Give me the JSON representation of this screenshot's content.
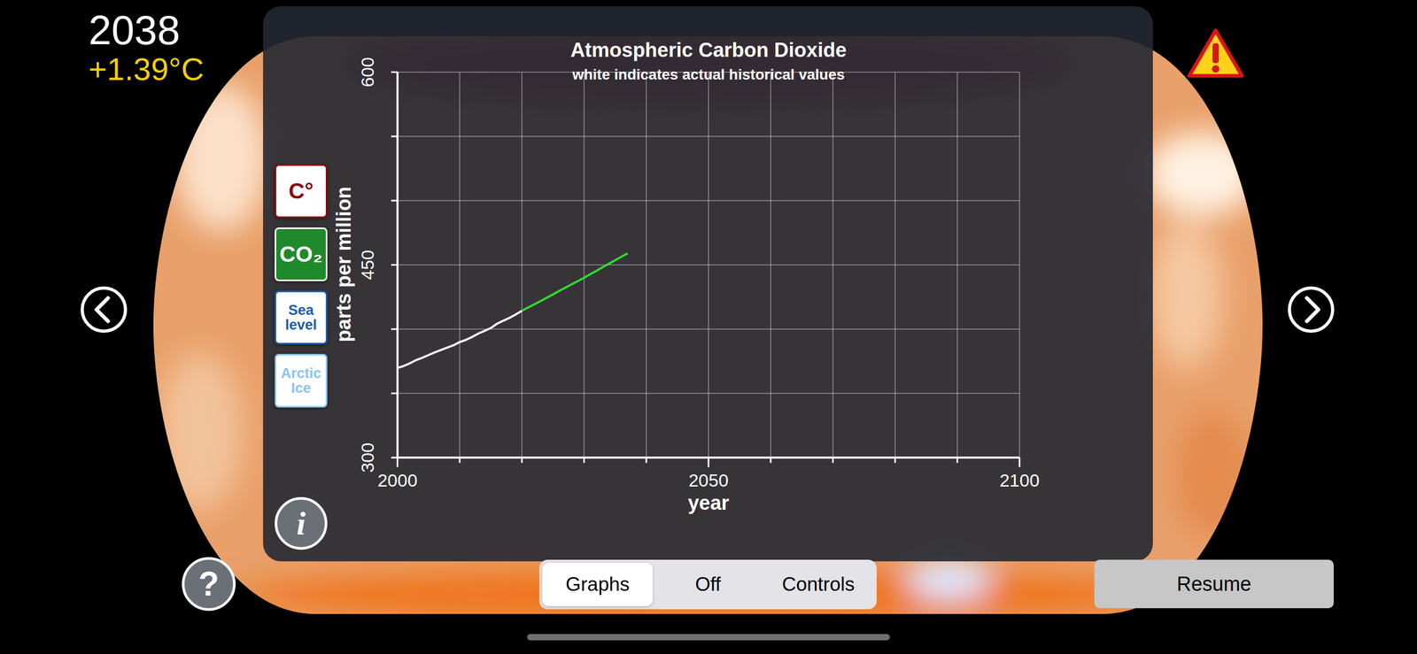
{
  "status": {
    "year": "2038",
    "temperature_anomaly": "+1.39°C"
  },
  "graph_selector": [
    {
      "label": "C°",
      "selected": false,
      "color": "#8b0a0a"
    },
    {
      "label": "CO₂",
      "selected": true,
      "color": "#1f8a2c"
    },
    {
      "label": "Sea level",
      "selected": false,
      "color": "#1a5fa8"
    },
    {
      "label": "Arctic Ice",
      "selected": false,
      "color": "#8cc4ef"
    }
  ],
  "info_button": "i",
  "help_button": "?",
  "chart": {
    "title": "Atmospheric Carbon Dioxide",
    "subtitle": "white indicates actual historical values",
    "y_axis": {
      "label": "parts per million",
      "ticks": [
        "300",
        "450",
        "600"
      ]
    },
    "x_axis": {
      "label": "year",
      "ticks": [
        "2000",
        "2050",
        "2100"
      ]
    },
    "series": [
      {
        "start_year": 2000,
        "color": "#ffffff",
        "values": [
          369.7,
          371.3,
          373.4,
          375.9,
          377.7,
          379.8,
          381.9,
          383.8,
          385.6,
          387.4,
          389.9,
          391.6,
          393.9,
          396.5,
          398.6,
          400.8,
          404.2,
          406.5,
          408.7,
          411.4,
          414.2
        ]
      },
      {
        "start_year": 2020,
        "color": "#2ee02e",
        "values": [
          414.2,
          416.8,
          419.3,
          421.8,
          424.4,
          427.0,
          429.7,
          432.3,
          434.8,
          437.4,
          440.0,
          442.7,
          445.4,
          448.2,
          450.9,
          453.6,
          456.3,
          459.0
        ]
      }
    ]
  },
  "view_modes": [
    {
      "label": "Graphs",
      "selected": true
    },
    {
      "label": "Off",
      "selected": false
    },
    {
      "label": "Controls",
      "selected": false
    }
  ],
  "resume_button": "Resume"
}
